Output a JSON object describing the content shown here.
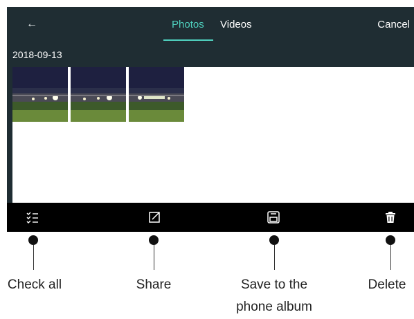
{
  "header": {
    "back_glyph": "←",
    "tabs": [
      {
        "label": "Photos",
        "active": true
      },
      {
        "label": "Videos",
        "active": false
      }
    ],
    "cancel_label": "Cancel"
  },
  "gallery": {
    "date": "2018-09-13",
    "thumbnail_count": 3
  },
  "toolbar": {
    "icons": [
      "check-all-icon",
      "share-icon",
      "save-icon",
      "delete-icon"
    ]
  },
  "callouts": {
    "check_all": "Check all",
    "share": "Share",
    "save_line1": "Save to the",
    "save_line2": "phone album",
    "delete": "Delete"
  },
  "colors": {
    "bar": "#1f2d33",
    "accent": "#4fd1bf",
    "toolbar": "#000000"
  }
}
